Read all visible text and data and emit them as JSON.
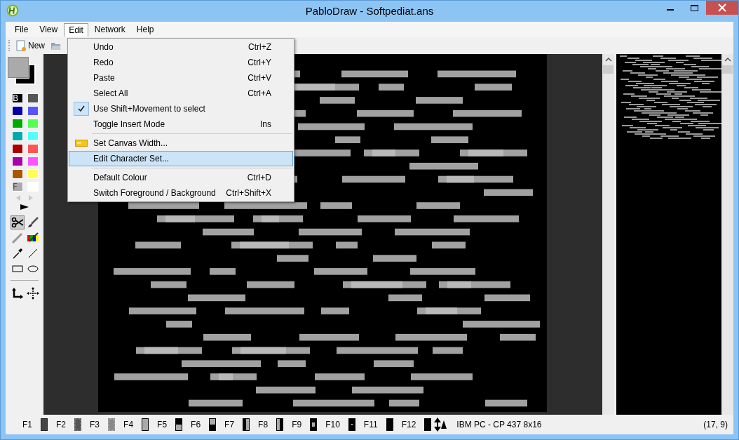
{
  "window": {
    "title": "PabloDraw - Softpediat.ans"
  },
  "menubar": [
    {
      "label": "File",
      "selected": false
    },
    {
      "label": "View",
      "selected": false
    },
    {
      "label": "Edit",
      "selected": true
    },
    {
      "label": "Network",
      "selected": false
    },
    {
      "label": "Help",
      "selected": false
    }
  ],
  "toolbar": [
    {
      "kind": "new",
      "label": "New"
    },
    {
      "kind": "open"
    }
  ],
  "edit_menu": [
    {
      "kind": "plain",
      "label": "Undo",
      "shortcut": "Ctrl+Z",
      "checked": false,
      "selected": false,
      "separator_before": false
    },
    {
      "kind": "plain",
      "label": "Redo",
      "shortcut": "Ctrl+Y",
      "checked": false,
      "selected": false,
      "separator_before": false
    },
    {
      "kind": "plain",
      "label": "Paste",
      "shortcut": "Ctrl+V",
      "checked": false,
      "selected": false,
      "separator_before": false
    },
    {
      "kind": "plain",
      "label": "Select All",
      "shortcut": "Ctrl+A",
      "checked": false,
      "selected": false,
      "separator_before": false
    },
    {
      "kind": "check",
      "label": "Use Shift+Movement to select",
      "checked": true,
      "selected": false,
      "separator_before": false
    },
    {
      "kind": "plain",
      "label": "Toggle Insert Mode",
      "shortcut": "Ins",
      "checked": false,
      "selected": false,
      "separator_before": false
    },
    {
      "kind": "icon",
      "label": "Set Canvas Width...",
      "checked": false,
      "selected": false,
      "separator_before": true
    },
    {
      "kind": "plain",
      "label": "Edit Character Set...",
      "checked": false,
      "selected": true,
      "separator_before": false
    },
    {
      "kind": "plain",
      "label": "Default Colour",
      "shortcut": "Ctrl+D",
      "checked": false,
      "selected": false,
      "separator_before": true
    },
    {
      "kind": "plain",
      "label": "Switch Foreground / Background",
      "shortcut": "Ctrl+Shift+X",
      "checked": false,
      "selected": false,
      "separator_before": false
    }
  ],
  "palette": [
    {
      "color": "#000000",
      "marker": "B",
      "background": true
    },
    {
      "color": "#555555"
    },
    {
      "color": "#0000aa"
    },
    {
      "color": "#5555ff"
    },
    {
      "color": "#00aa00"
    },
    {
      "color": "#55ff55"
    },
    {
      "color": "#00aaaa"
    },
    {
      "color": "#55ffff"
    },
    {
      "color": "#aa0000"
    },
    {
      "color": "#ff5555"
    },
    {
      "color": "#aa00aa"
    },
    {
      "color": "#ff55ff"
    },
    {
      "color": "#aa5500"
    },
    {
      "color": "#ffff55"
    },
    {
      "color": "#aaaaaa",
      "marker": "F",
      "foreground": true
    },
    {
      "color": "#ffffff"
    }
  ],
  "tools": [
    {
      "kind": "select",
      "selected": true
    },
    {
      "kind": "brush",
      "selected": false
    },
    {
      "kind": "pencil",
      "selected": false
    },
    {
      "kind": "color-brush",
      "selected": false
    },
    {
      "kind": "eyedropper",
      "selected": false
    },
    {
      "kind": "line",
      "selected": false
    },
    {
      "kind": "rectangle",
      "selected": false
    },
    {
      "kind": "ellipse",
      "selected": false
    }
  ],
  "status_bar": {
    "keys": [
      {
        "label": "F1",
        "kind": "dark-shade"
      },
      {
        "label": "F2",
        "kind": "medium-shade"
      },
      {
        "label": "F3",
        "kind": "light-shade"
      },
      {
        "label": "F4",
        "kind": "block"
      },
      {
        "label": "F5",
        "kind": "upper-half"
      },
      {
        "label": "F6",
        "kind": "lower-half"
      },
      {
        "label": "F7",
        "kind": "left-half"
      },
      {
        "label": "F8",
        "kind": "right-half"
      },
      {
        "label": "F9",
        "kind": "square"
      },
      {
        "label": "F10",
        "kind": "dot"
      },
      {
        "label": "F11",
        "kind": "full"
      },
      {
        "label": "F12",
        "kind": "full"
      }
    ],
    "font": "IBM PC - CP 437 8x16",
    "position": "(17, 9)"
  }
}
